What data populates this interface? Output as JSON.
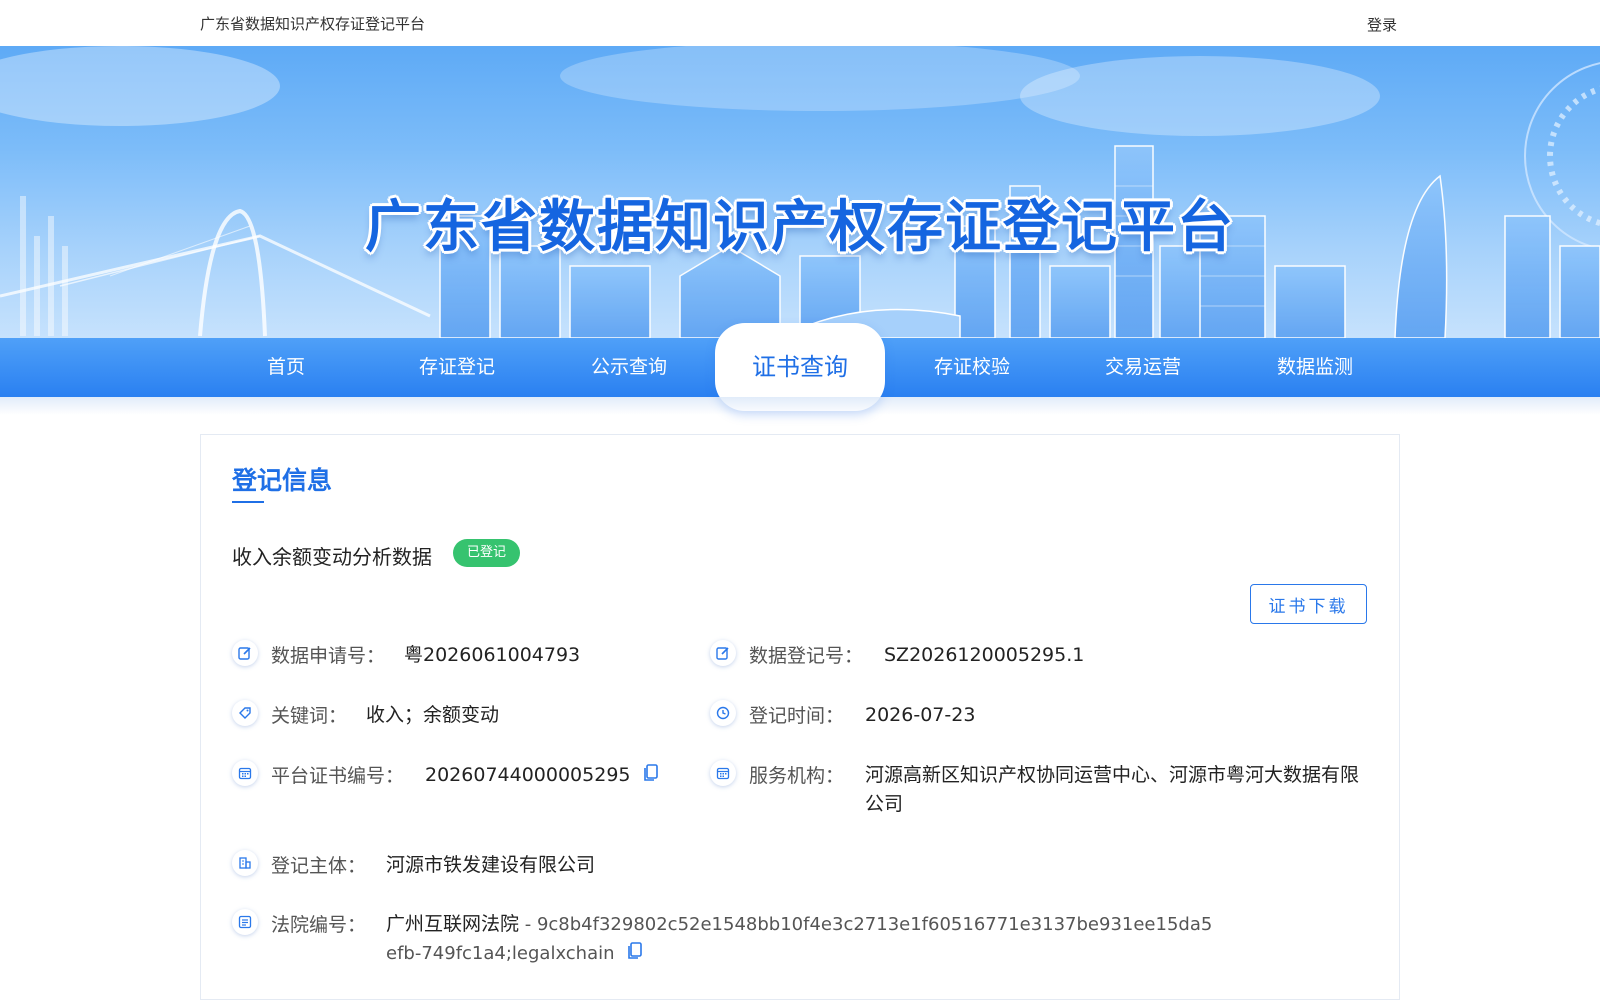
{
  "topbar": {
    "site_name": "广东省数据知识产权存证登记平台",
    "login": "登录"
  },
  "banner": {
    "title": "广东省数据知识产权存证登记平台"
  },
  "nav": {
    "items": [
      {
        "label": "首页"
      },
      {
        "label": "存证登记"
      },
      {
        "label": "公示查询"
      },
      {
        "label": "证书查询"
      },
      {
        "label": "存证校验"
      },
      {
        "label": "交易运营"
      },
      {
        "label": "数据监测"
      }
    ],
    "active_index": 3
  },
  "record": {
    "section_title": "登记信息",
    "data_name": "收入余额变动分析数据",
    "status": "已登记",
    "download_label": "证书下载",
    "fields": {
      "application_no": {
        "label": "数据申请号：",
        "value": "粤2026061004793",
        "icon": "edit-icon"
      },
      "registration_no": {
        "label": "数据登记号：",
        "value": "SZ2026120005295.1",
        "icon": "edit-icon"
      },
      "keywords": {
        "label": "关键词：",
        "value": "收入；余额变动",
        "icon": "tag-icon"
      },
      "registration_time": {
        "label": "登记时间：",
        "value": "2026-07-23",
        "icon": "clock-icon"
      },
      "certificate_no": {
        "label": "平台证书编号：",
        "value": "20260744000005295",
        "icon": "calendar-icon"
      },
      "service_org": {
        "label": "服务机构：",
        "value": "河源高新区知识产权协同运营中心、河源市粤河大数据有限公司",
        "icon": "calendar-icon"
      },
      "subject": {
        "label": "登记主体：",
        "value": "河源市铁发建设有限公司",
        "icon": "building-icon"
      },
      "court_no": {
        "label": "法院编号：",
        "court": "广州互联网法院",
        "value": " - 9c8b4f329802c52e1548bb10f4e3c2713e1f60516771e3137be931ee15da5efb-749fc1a4;legalxchain",
        "icon": "list-icon"
      }
    }
  },
  "colors": {
    "primary": "#1f6fe6",
    "nav_bg": "#2a80f1",
    "badge": "#36c36f"
  }
}
